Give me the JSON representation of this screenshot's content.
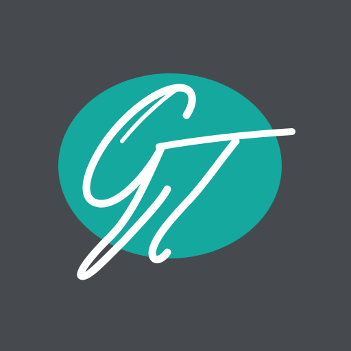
{
  "colors": {
    "background": "#46494e",
    "oval": "#14a89e",
    "monogram": "#ffffff"
  },
  "logo": {
    "type": "monogram",
    "letters": "GT",
    "style": "script"
  }
}
